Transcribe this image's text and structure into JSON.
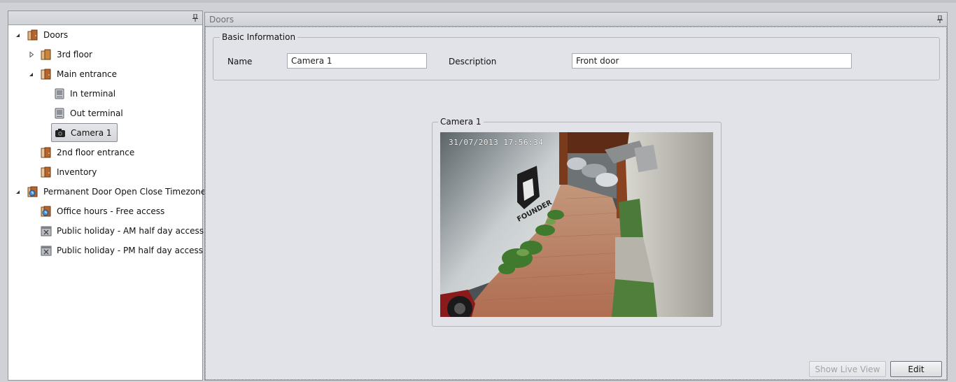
{
  "tree": {
    "items": [
      {
        "label": "Doors",
        "icon": "door-folder-icon",
        "expander": "expanded"
      },
      {
        "label": "3rd floor",
        "icon": "door-folder-icon",
        "expander": "collapsed"
      },
      {
        "label": "Main entrance",
        "icon": "door-icon",
        "expander": "expanded"
      },
      {
        "label": "In terminal",
        "icon": "terminal-icon",
        "expander": "none"
      },
      {
        "label": "Out terminal",
        "icon": "terminal-icon",
        "expander": "none"
      },
      {
        "label": "Camera 1",
        "icon": "camera-icon",
        "expander": "none",
        "selected": true
      },
      {
        "label": "2nd floor entrance",
        "icon": "door-icon",
        "expander": "none"
      },
      {
        "label": "Inventory",
        "icon": "door-icon",
        "expander": "none"
      },
      {
        "label": "Permanent Door Open Close Timezone",
        "icon": "timezone-icon",
        "expander": "expanded"
      },
      {
        "label": "Office hours - Free access",
        "icon": "timezone-icon",
        "expander": "none"
      },
      {
        "label": "Public holiday - AM half day access",
        "icon": "holiday-icon",
        "expander": "none"
      },
      {
        "label": "Public holiday - PM half day access",
        "icon": "holiday-icon",
        "expander": "none"
      }
    ]
  },
  "detail": {
    "title": "Doors",
    "basic_info_title": "Basic Information",
    "name_label": "Name",
    "name_value": "Camera 1",
    "description_label": "Description",
    "description_value": "Front door",
    "camera_group_title": "Camera 1",
    "camera_timestamp": "31/07/2013  17:56:34",
    "camera_watermark": "FOUNDER"
  },
  "buttons": {
    "show_live_view": "Show Live View",
    "edit": "Edit"
  },
  "colors": {
    "door": "#b5652e",
    "terminal": "#8e9197",
    "selection": "#d8dadd"
  }
}
